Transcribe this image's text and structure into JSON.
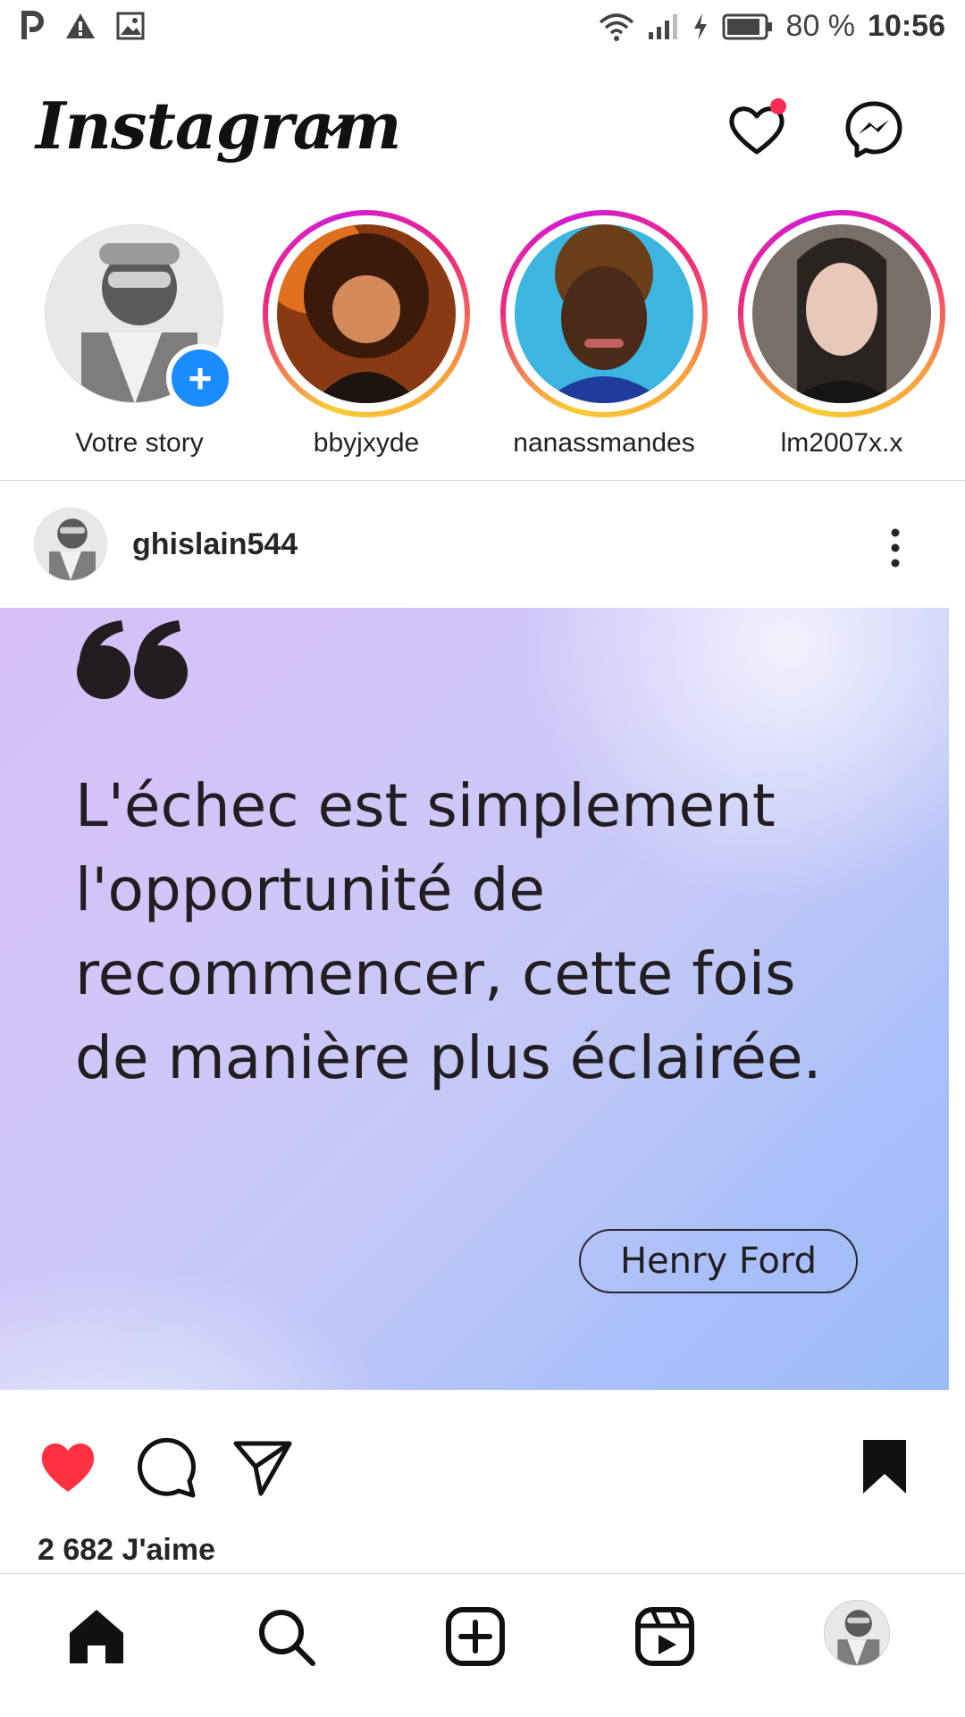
{
  "status_bar": {
    "battery": "80 %",
    "time": "10:56",
    "left_icons": [
      "parking-icon",
      "warning-icon",
      "image-icon"
    ],
    "right_icons": [
      "wifi-icon",
      "signal-icon",
      "charging-icon",
      "battery-icon"
    ]
  },
  "header": {
    "logo": "Instagram",
    "icons": [
      "chevron-down-icon",
      "heart-icon",
      "messenger-icon"
    ],
    "notification_dot_color": "#ff2d55"
  },
  "stories": [
    {
      "name": "Votre story",
      "own": true
    },
    {
      "name": "bbyjxyde"
    },
    {
      "name": "nanassmandes"
    },
    {
      "name": "lm2007x.x"
    }
  ],
  "post": {
    "username": "ghislain544",
    "quote": "L'échec est simplement l'opportunité de recommencer, cette fois de manière plus éclairée.",
    "author": "Henry Ford",
    "likes": "2 682 J'aime",
    "like_color": "#ff3040"
  },
  "bottom_nav": {
    "items": [
      "home-icon",
      "search-icon",
      "create-icon",
      "reels-icon",
      "profile-avatar"
    ]
  }
}
